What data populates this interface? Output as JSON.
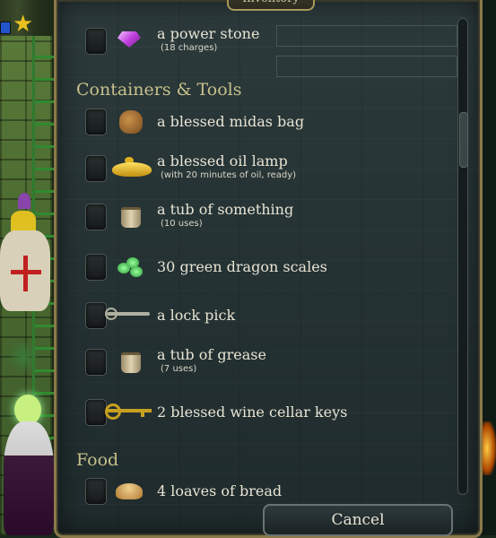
{
  "window": {
    "title": "Inventory"
  },
  "sections": {
    "containers_tools": "Containers & Tools",
    "food": "Food"
  },
  "items": {
    "power_stone": {
      "name": "a power stone",
      "note": "(18 charges)",
      "icon": "gem-icon"
    },
    "midas_bag": {
      "name": "a blessed midas bag",
      "icon": "bag-icon"
    },
    "oil_lamp": {
      "name": "a blessed oil lamp",
      "note": "(with 20 minutes of oil, ready)",
      "icon": "lamp-icon"
    },
    "tub_something": {
      "name": "a tub of something",
      "note": "(10 uses)",
      "icon": "tub-icon"
    },
    "dragon_scales": {
      "name": "30 green dragon scales",
      "icon": "scales-icon"
    },
    "lock_pick": {
      "name": "a lock pick",
      "icon": "lockpick-icon"
    },
    "tub_grease": {
      "name": "a tub of grease",
      "note": "(7 uses)",
      "icon": "tub-icon"
    },
    "wine_keys": {
      "name": "2 blessed wine cellar keys",
      "icon": "key-icon"
    },
    "bread": {
      "name": "4 loaves of bread",
      "icon": "bread-icon"
    }
  },
  "buttons": {
    "cancel": "Cancel"
  },
  "colors": {
    "panel_border": "#8a7a4a",
    "section_text": "#c6c08a",
    "item_text": "#e8e4d4"
  }
}
